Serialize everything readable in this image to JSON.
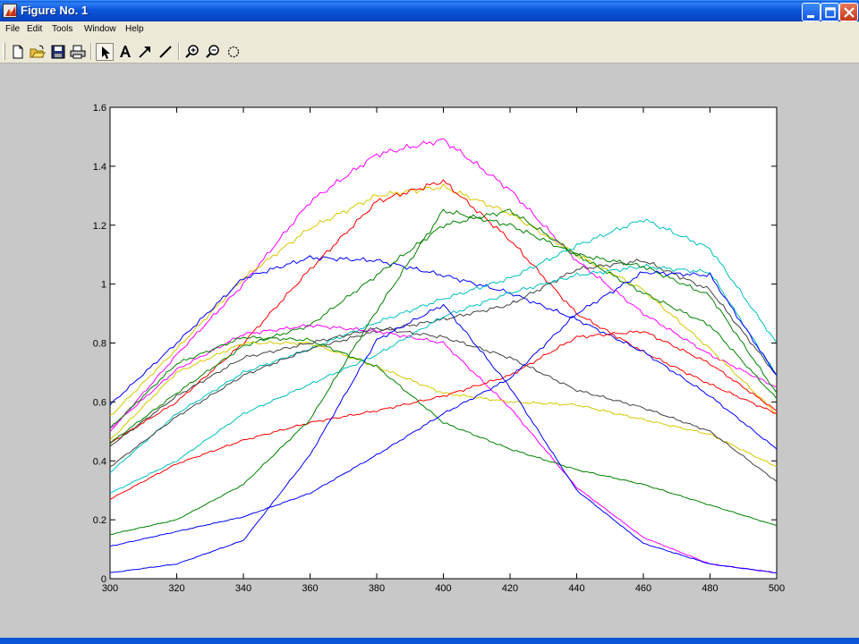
{
  "window": {
    "title": "Figure No. 1",
    "controls": [
      "minimize",
      "maximize",
      "close"
    ]
  },
  "menu": [
    "File",
    "Edit",
    "Tools",
    "Window",
    "Help"
  ],
  "toolbar": {
    "buttons": [
      {
        "name": "new-figure-icon"
      },
      {
        "name": "open-file-icon"
      },
      {
        "name": "save-icon"
      },
      {
        "name": "print-icon"
      },
      {
        "name": "select-arrow-icon"
      },
      {
        "name": "insert-text-icon"
      },
      {
        "name": "insert-arrow-icon"
      },
      {
        "name": "insert-line-icon"
      },
      {
        "name": "zoom-in-icon"
      },
      {
        "name": "zoom-out-icon"
      },
      {
        "name": "rotate-3d-icon"
      }
    ]
  },
  "chart_data": {
    "type": "line",
    "title": "",
    "xlabel": "",
    "ylabel": "",
    "xlim": [
      300,
      500
    ],
    "ylim": [
      0,
      1.6
    ],
    "xticks": [
      300,
      320,
      340,
      360,
      380,
      400,
      420,
      440,
      460,
      480,
      500
    ],
    "yticks": [
      0,
      0.2,
      0.4,
      0.6,
      0.8,
      1,
      1.2,
      1.4,
      1.6
    ],
    "ytick_labels": [
      "0",
      "0.2",
      "0.4",
      "0.6",
      "0.8",
      "1",
      "1.2",
      "1.4",
      "1.6"
    ],
    "grid": false,
    "legend": "none",
    "x": [
      300,
      320,
      340,
      360,
      380,
      400,
      420,
      440,
      460,
      480,
      500
    ],
    "series": [
      {
        "color": "#ff00ff",
        "values": [
          0.5,
          0.76,
          1.0,
          1.28,
          1.44,
          1.49,
          1.32,
          1.08,
          0.9,
          0.76,
          0.65
        ]
      },
      {
        "color": "#d4c800",
        "values": [
          0.55,
          0.78,
          1.02,
          1.19,
          1.3,
          1.33,
          1.24,
          1.1,
          0.98,
          0.78,
          0.56
        ]
      },
      {
        "color": "#ff0000",
        "values": [
          0.46,
          0.6,
          0.8,
          1.05,
          1.28,
          1.35,
          1.15,
          0.9,
          0.77,
          0.66,
          0.56
        ]
      },
      {
        "color": "#0000ff",
        "values": [
          0.59,
          0.8,
          1.02,
          1.09,
          1.08,
          1.03,
          0.97,
          0.88,
          0.77,
          0.62,
          0.44
        ]
      },
      {
        "color": "#008000",
        "values": [
          0.46,
          0.63,
          0.79,
          0.86,
          1.03,
          1.2,
          1.25,
          1.1,
          0.97,
          0.86,
          0.61
        ]
      },
      {
        "color": "#00bfbf",
        "values": [
          0.36,
          0.56,
          0.7,
          0.78,
          0.87,
          0.95,
          1.02,
          1.13,
          1.22,
          1.12,
          0.8
        ]
      },
      {
        "color": "#404040",
        "values": [
          0.38,
          0.55,
          0.69,
          0.78,
          0.84,
          0.88,
          0.93,
          1.05,
          1.08,
          0.98,
          0.69
        ]
      },
      {
        "color": "#ff00ff",
        "values": [
          0.51,
          0.71,
          0.83,
          0.86,
          0.84,
          0.8,
          0.58,
          0.31,
          0.14,
          0.05,
          0.02
        ]
      },
      {
        "color": "#d4c800",
        "values": [
          0.47,
          0.7,
          0.8,
          0.8,
          0.72,
          0.63,
          0.6,
          0.59,
          0.54,
          0.49,
          0.38
        ]
      },
      {
        "color": "#008000",
        "values": [
          0.51,
          0.73,
          0.82,
          0.81,
          0.72,
          0.53,
          0.44,
          0.37,
          0.32,
          0.25,
          0.18
        ]
      },
      {
        "color": "#00bfbf",
        "values": [
          0.29,
          0.4,
          0.56,
          0.66,
          0.76,
          0.89,
          0.97,
          1.03,
          1.06,
          1.04,
          0.69
        ]
      },
      {
        "color": "#ff0000",
        "values": [
          0.27,
          0.39,
          0.47,
          0.53,
          0.57,
          0.62,
          0.69,
          0.82,
          0.84,
          0.73,
          0.57
        ]
      },
      {
        "color": "#008000",
        "values": [
          0.15,
          0.2,
          0.32,
          0.54,
          0.91,
          1.25,
          1.2,
          1.1,
          1.06,
          0.96,
          0.63
        ]
      },
      {
        "color": "#404040",
        "values": [
          0.45,
          0.62,
          0.75,
          0.8,
          0.85,
          0.82,
          0.75,
          0.64,
          0.58,
          0.5,
          0.33
        ]
      },
      {
        "color": "#0000ff",
        "values": [
          0.11,
          0.16,
          0.21,
          0.29,
          0.42,
          0.56,
          0.68,
          0.9,
          1.04,
          1.03,
          0.69
        ]
      },
      {
        "color": "#0000ff",
        "values": [
          0.02,
          0.05,
          0.13,
          0.42,
          0.81,
          0.93,
          0.65,
          0.3,
          0.12,
          0.05,
          0.02
        ]
      }
    ]
  }
}
